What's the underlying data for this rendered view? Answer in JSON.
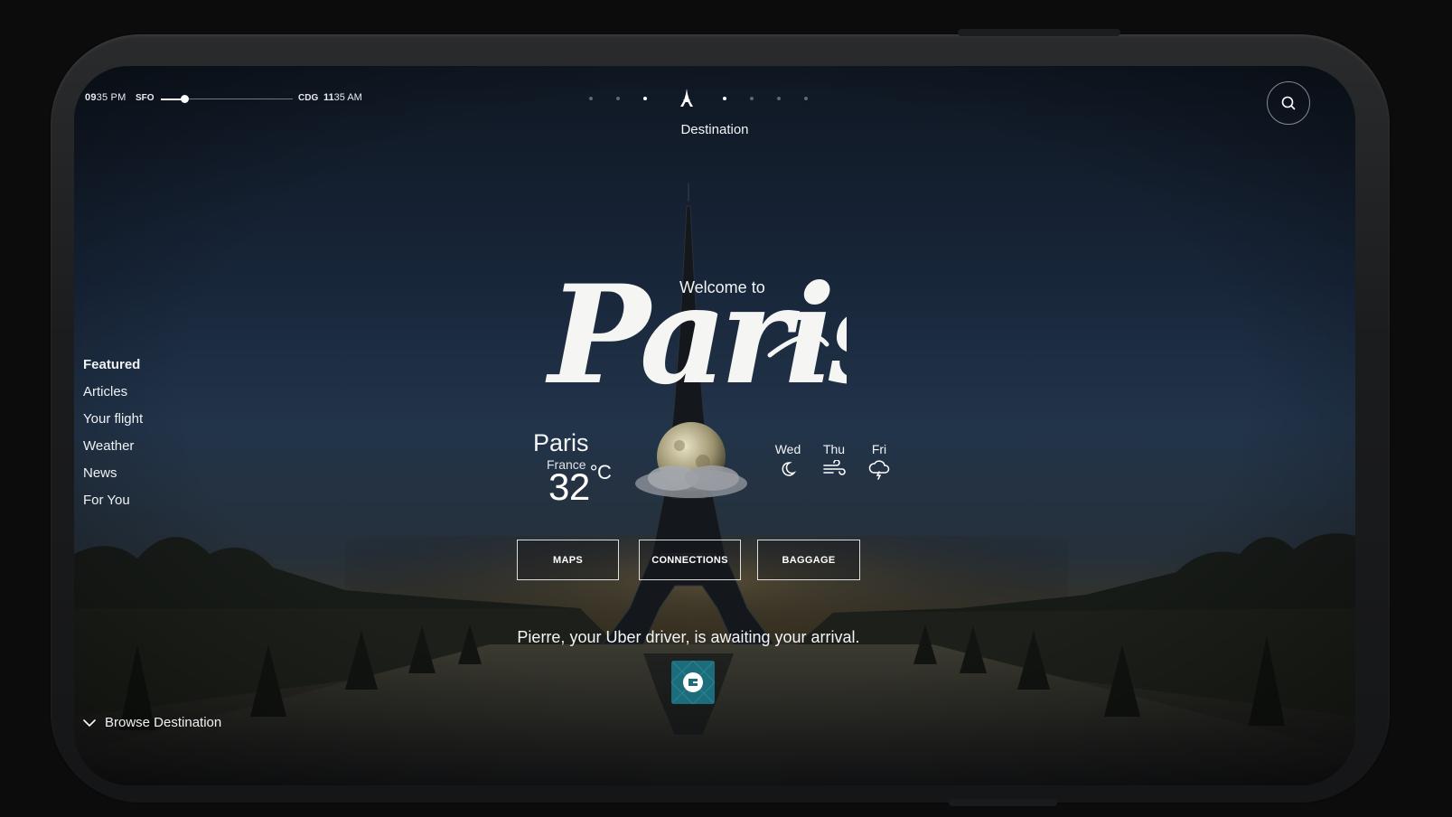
{
  "topbar": {
    "time_left_hh": "09",
    "time_left_rest": "35 PM",
    "origin_code": "SFO",
    "dest_code": "CDG",
    "time_right_hh": "11",
    "time_right_rest": "35 AM",
    "flight_progress": 0.18,
    "section_title": "Destination"
  },
  "sidebar": {
    "items": [
      {
        "label": "Featured",
        "active": true
      },
      {
        "label": "Articles"
      },
      {
        "label": "Your flight"
      },
      {
        "label": "Weather"
      },
      {
        "label": "News"
      },
      {
        "label": "For You"
      }
    ]
  },
  "hero": {
    "welcome": "Welcome to",
    "script_city": "Paris"
  },
  "weather": {
    "city": "Paris",
    "country": "France",
    "temp": "32",
    "unit": "°C",
    "forecast": [
      {
        "day": "Wed",
        "icon": "moon-icon"
      },
      {
        "day": "Thu",
        "icon": "wind-icon"
      },
      {
        "day": "Fri",
        "icon": "thunderstorm-icon"
      }
    ]
  },
  "actions": {
    "maps": "MAPS",
    "connections": "CONNECTIONS",
    "baggage": "BAGGAGE"
  },
  "uber": {
    "message": "Pierre, your Uber driver, is awaiting your arrival."
  },
  "footer": {
    "browse": "Browse Destination"
  }
}
